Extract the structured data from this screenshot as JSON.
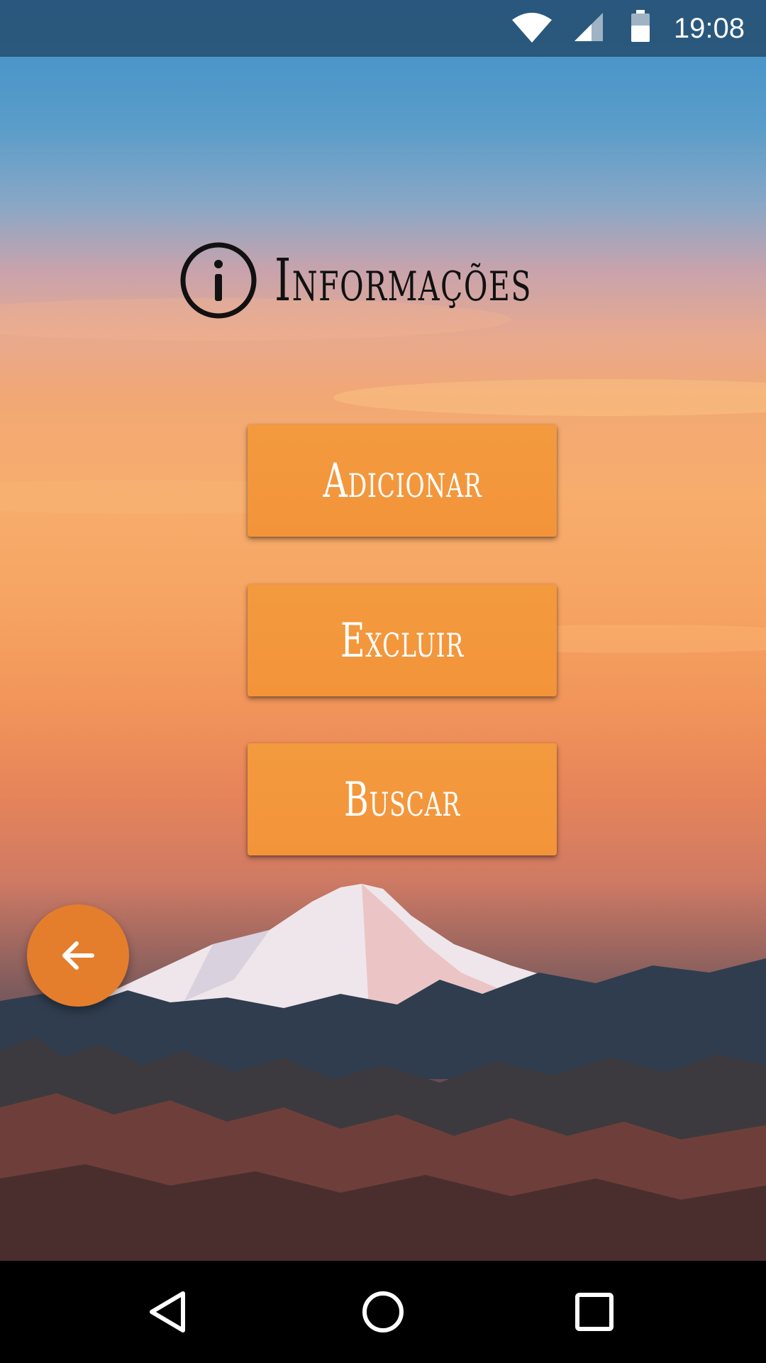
{
  "status_bar": {
    "time": "19:08",
    "icons": [
      "wifi-icon",
      "cell-signal-icon",
      "battery-icon"
    ]
  },
  "header": {
    "title": "Informações",
    "icon": "info-icon"
  },
  "menu": {
    "buttons": [
      {
        "label": "Adicionar"
      },
      {
        "label": "Excluir"
      },
      {
        "label": "Buscar"
      }
    ]
  },
  "fab": {
    "icon": "arrow-left-icon"
  },
  "nav_bar": {
    "icons": [
      "back-triangle-icon",
      "home-circle-icon",
      "recents-square-icon"
    ]
  },
  "colors": {
    "button": "#f3963c",
    "fab": "#e57e2c",
    "status_bar": "#264e70",
    "title_text": "#111111"
  }
}
